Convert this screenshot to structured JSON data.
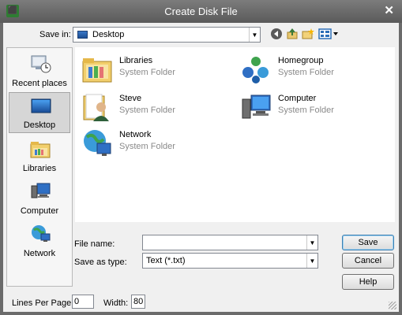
{
  "window": {
    "title": "Create Disk File"
  },
  "toolbar": {
    "save_in_label": "Save in:",
    "save_in_value": "Desktop"
  },
  "places": [
    {
      "label": "Recent places",
      "icon": "recent-places-icon"
    },
    {
      "label": "Desktop",
      "icon": "desktop-icon",
      "selected": true
    },
    {
      "label": "Libraries",
      "icon": "libraries-icon"
    },
    {
      "label": "Computer",
      "icon": "computer-icon"
    },
    {
      "label": "Network",
      "icon": "network-icon"
    }
  ],
  "files": [
    {
      "name": "Libraries",
      "type": "System Folder",
      "icon": "libraries-folder-icon"
    },
    {
      "name": "Homegroup",
      "type": "System Folder",
      "icon": "homegroup-icon"
    },
    {
      "name": "Steve",
      "type": "System Folder",
      "icon": "user-folder-icon"
    },
    {
      "name": "Computer",
      "type": "System Folder",
      "icon": "computer-icon"
    },
    {
      "name": "Network",
      "type": "System Folder",
      "icon": "network-icon"
    }
  ],
  "form": {
    "file_name_label": "File name:",
    "file_name_value": "",
    "save_as_type_label": "Save as type:",
    "save_as_type_value": "Text (*.txt)",
    "lines_per_page_label": "Lines Per Page:",
    "lines_per_page_value": "0",
    "width_label": "Width:",
    "width_value": "80"
  },
  "buttons": {
    "save": "Save",
    "cancel": "Cancel",
    "help": "Help"
  }
}
